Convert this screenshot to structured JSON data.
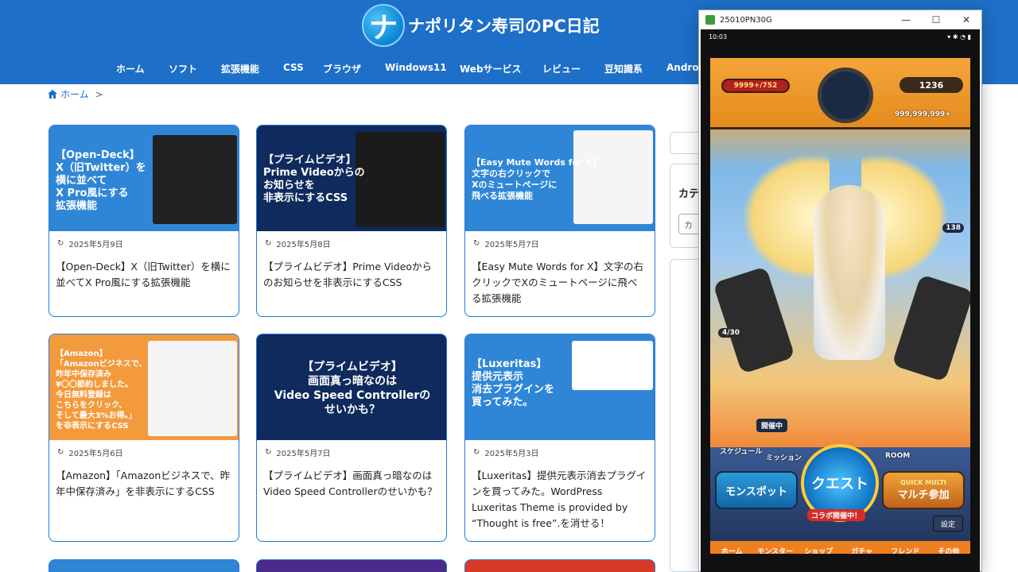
{
  "site": {
    "logo_letter": "ナ",
    "title": "ナポリタン寿司のPC日記",
    "nav": [
      "ホーム",
      "ソフト",
      "拡張機能",
      "CSS",
      "ブラウザ",
      "Windows11",
      "Webサービス",
      "レビュー",
      "豆知識系",
      "Android"
    ]
  },
  "breadcrumb": {
    "home": "ホーム",
    "sep": ">"
  },
  "cards": [
    {
      "thumb_text": "【Open-Deck】\nX（旧Twitter）を\n横に並べて\nX Pro風にする\n拡張機能",
      "thumb_bg": "#2f86d6",
      "date": "2025年5月9日",
      "title": "【Open-Deck】X（旧Twitter）を横に並べてX Pro風にする拡張機能"
    },
    {
      "thumb_text": "【プライムビデオ】\nPrime Videoからの\nお知らせを\n非表示にするCSS",
      "thumb_bg": "#0f2a5c",
      "date": "2025年5月8日",
      "title": "【プライムビデオ】Prime Videoからのお知らせを非表示にするCSS"
    },
    {
      "thumb_text": "【Easy Mute Words for X】\n文字の右クリックで\nXのミュートページに\n飛べる拡張機能",
      "thumb_bg": "#2f86d6",
      "date": "2025年5月7日",
      "title": "【Easy Mute Words for X】文字の右クリックでXのミュートページに飛べる拡張機能"
    },
    {
      "thumb_text": "【Amazon】\n「Amazonビジネスで、\n昨年中保存済み\n¥〇〇節約しました。\n今日無料登録は\nこちらをクリック、\nそして最大3%お得。」\nを非表示にするCSS",
      "thumb_bg": "#f39a3c",
      "date": "2025年5月6日",
      "title": "【Amazon】「Amazonビジネスで、昨年中保存済み」を非表示にするCSS"
    },
    {
      "thumb_text": "【プライムビデオ】\n画面真っ暗なのは\nVideo Speed Controllerの\nせいかも？",
      "thumb_bg": "#0f2a5c",
      "date": "2025年5月7日",
      "title": "【プライムビデオ】画面真っ暗なのはVideo Speed Controllerのせいかも？"
    },
    {
      "thumb_text": "【Luxeritas】\n提供元表示\n消去プラグインを\n買ってみた。",
      "thumb_bg": "#2f86d6",
      "date": "2025年5月3日",
      "title": "【Luxeritas】提供元表示消去プラグインを買ってみた。WordPress Luxeritas Theme is provided by “Thought is free”.を消せる！"
    }
  ],
  "sidebar": {
    "heading_partial": "カテ",
    "select_partial": "カ"
  },
  "window": {
    "title": "25010PN30G",
    "controls": [
      "—",
      "☐",
      "✕"
    ]
  },
  "game": {
    "time": "10:03",
    "stamina": "9999+/752",
    "gems": "1236",
    "coins": "999,999,999+",
    "shots": "4/30",
    "side_count": "138",
    "event": "開催中",
    "schedule": "スケジュール",
    "mission": "ミッション",
    "room": "ROOM",
    "mon_spot": "モンスポット",
    "quest": "クエスト",
    "collab": "コラボ開催中！",
    "quick_multi": "QUICK MULTI",
    "multi": "マルチ参加",
    "settings": "設定",
    "bottom_nav": [
      "ホーム",
      "モンスター",
      "ショップ",
      "ガチャ",
      "フレンド",
      "その他"
    ]
  }
}
